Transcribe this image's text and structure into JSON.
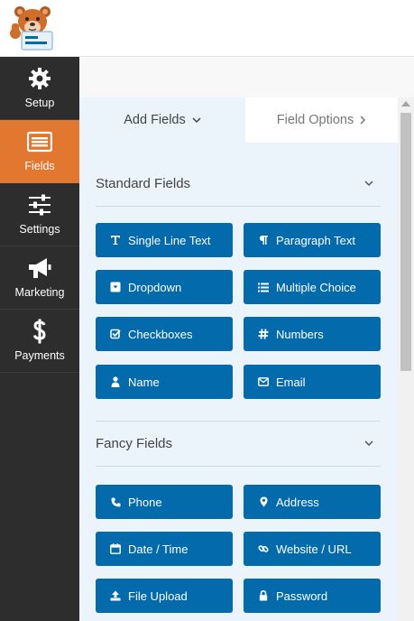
{
  "sidebar": {
    "items": [
      {
        "label": "Setup",
        "icon": "gear-icon"
      },
      {
        "label": "Fields",
        "icon": "fields-icon",
        "active": true
      },
      {
        "label": "Settings",
        "icon": "sliders-icon"
      },
      {
        "label": "Marketing",
        "icon": "megaphone-icon"
      },
      {
        "label": "Payments",
        "icon": "dollar-icon"
      }
    ]
  },
  "tabs": {
    "add_fields": "Add Fields",
    "field_options": "Field Options"
  },
  "sections": {
    "standard": {
      "title": "Standard Fields",
      "buttons": [
        "Single Line Text",
        "Paragraph Text",
        "Dropdown",
        "Multiple Choice",
        "Checkboxes",
        "Numbers",
        "Name",
        "Email"
      ]
    },
    "fancy": {
      "title": "Fancy Fields",
      "buttons": [
        "Phone",
        "Address",
        "Date / Time",
        "Website / URL",
        "File Upload",
        "Password"
      ]
    }
  },
  "colors": {
    "sidebar_bg": "#2d2d2d",
    "active_orange": "#e27730",
    "button_blue": "#036aab",
    "panel_bg": "#ebf3fb"
  }
}
